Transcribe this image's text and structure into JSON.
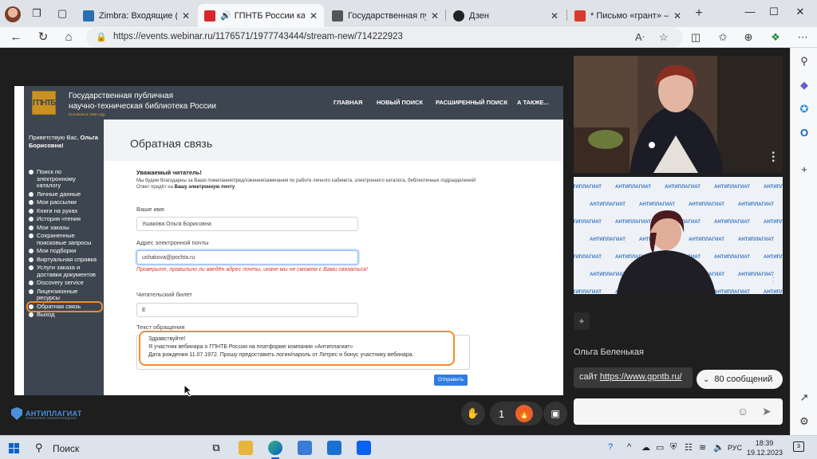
{
  "browser": {
    "tabs": [
      {
        "title": "Zimbra: Входящие (2)",
        "favicon_color": "#2a6fb0"
      },
      {
        "title": "ГПНТБ России как то",
        "favicon_color": "#d7262e"
      },
      {
        "title": "Государственная публич",
        "favicon_color": "#555555"
      },
      {
        "title": "Дзен",
        "favicon_color": "#222222"
      },
      {
        "title": "* Письмо «грант» — Mih",
        "favicon_color": "#d93a2c"
      }
    ],
    "new_tab_icon": "+",
    "url": "https://events.webinar.ru/1176571/1977743444/stream-new/714222923"
  },
  "shared_screen": {
    "header": {
      "logo_text": "ГПНТБ",
      "title_line1": "Государственная публичная",
      "title_line2": "научно-техническая библиотека России",
      "founded": "Основана в 1958 году",
      "nav": [
        "ГЛАВНАЯ",
        "НОВЫЙ ПОИСК",
        "РАСШИРЕННЫЙ ПОИСК",
        "А ТАКЖЕ..."
      ]
    },
    "sidebar": {
      "greeting": "Приветствую Вас,",
      "user_name": "Ольга Борисовна!",
      "items": [
        "Поиск по электронному каталогу",
        "Личные данные",
        "Мои рассылки",
        "Книги на руках",
        "История чтения",
        "Мои заказы",
        "Сохраненные поисковые запросы",
        "Мои подборки",
        "Виртуальная справка",
        "Услуги заказа и доставки документов",
        "Discovery service",
        "Лицензионные ресурсы",
        "Обратная связь",
        "Выход"
      ]
    },
    "form": {
      "page_title": "Обратная связь",
      "dear": "Уважаемый читатель!",
      "intro": "Мы будем благодарны за Ваши пожелания/предложения/замечания по работе личного кабинета, электронного каталога, библиотечных подразделений!",
      "intro_line2": "Ответ придёт на",
      "intro_bold": "Вашу электронную почту",
      "name_label": "Ваше имя",
      "name_value": "Ушакова Ольга Борисовна",
      "email_label": "Адрес электронной почты",
      "email_value": "ushakova@pochta.ru",
      "email_error": "Проверьте, правильно ли введён адрес почты, иначе мы не сможем с Вами связаться!",
      "ticket_label": "Читательский билет",
      "ticket_value": "Е",
      "message_label": "Текст обращения",
      "message_lines": [
        "Здравствуйте!",
        "Я участник вебинара о ГПНТБ России на платформе компании «Антиплагиат»",
        "Дата рождения 11.07.1972. Прошу предоставить логин/пароль от Литрес и бонус участнику вебинара."
      ],
      "send_label": "Отправить"
    }
  },
  "webinar": {
    "brand_name": "АНТИПЛАГИАТ",
    "brand_tagline": "СОХРАНЯЕМ ЗНАНИЯ ВОЕДИНО",
    "counter": "1",
    "backdrop_word": "АНТИПЛАГИАТ",
    "chat": {
      "author": "Ольга Беленькая",
      "message_prefix": "сайт ",
      "message_link": "https://www.gpntb.ru/",
      "messages_count": "80 сообщений",
      "add_label": "+"
    }
  },
  "taskbar": {
    "search_label": "Поиск",
    "language": "РУС",
    "time": "18:39",
    "date": "19.12.2023",
    "notifications": "3"
  },
  "colors": {
    "accent_orange": "#f28c28",
    "site_dark": "#3d4650",
    "brand_blue": "#4a90d9",
    "link_blue": "#2f7de1",
    "error_red": "#d9362b"
  }
}
